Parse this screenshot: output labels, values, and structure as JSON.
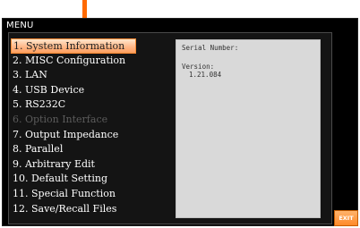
{
  "header": {
    "title": "MENU"
  },
  "menu": {
    "selected_index": 0,
    "items": [
      {
        "label": "1. System Information",
        "state": "selected"
      },
      {
        "label": "2. MISC Configuration",
        "state": "normal"
      },
      {
        "label": "3. LAN",
        "state": "normal"
      },
      {
        "label": "4. USB Device",
        "state": "normal"
      },
      {
        "label": "5. RS232C",
        "state": "normal"
      },
      {
        "label": "6. Option Interface",
        "state": "disabled"
      },
      {
        "label": "7. Output Impedance",
        "state": "normal"
      },
      {
        "label": "8. Parallel",
        "state": "normal"
      },
      {
        "label": "9. Arbitrary Edit",
        "state": "normal"
      },
      {
        "label": "10. Default Setting",
        "state": "normal"
      },
      {
        "label": "11. Special Function",
        "state": "normal"
      },
      {
        "label": "12. Save/Recall Files",
        "state": "normal"
      }
    ]
  },
  "info": {
    "serial_label": "Serial Number:",
    "serial_value": "",
    "version_label": "Version:",
    "version_value": "1.21.084"
  },
  "softkeys": {
    "exit_label": "EXIT"
  },
  "colors": {
    "accent": "#ff8a2a",
    "callout": "#ff6a00",
    "screen_bg": "#000000",
    "info_bg": "#d9d9d9",
    "disabled_text": "#5c5c5c"
  }
}
